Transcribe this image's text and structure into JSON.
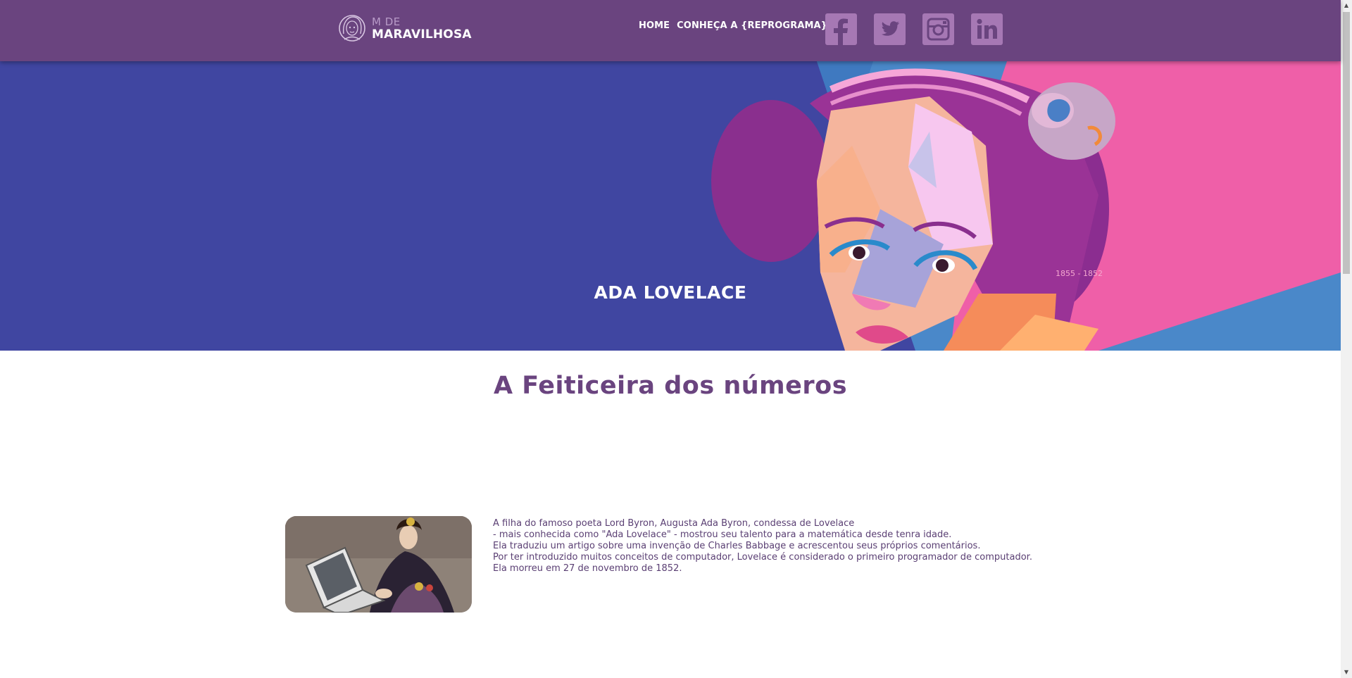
{
  "header": {
    "logo": {
      "line1": "M DE",
      "line2": "MARAVILHOSA",
      "icon": "woman-face-icon"
    },
    "nav": [
      {
        "label": "HOME"
      },
      {
        "label": "CONHEÇA A {REPROGRAMA}"
      }
    ],
    "social": [
      {
        "icon": "facebook-icon"
      },
      {
        "icon": "twitter-icon"
      },
      {
        "icon": "instagram-icon"
      },
      {
        "icon": "linkedin-icon"
      }
    ]
  },
  "hero": {
    "title": "ADA LOVELACE",
    "years": "1855 - 1852"
  },
  "main": {
    "title": "A Feiticeira dos números",
    "bio": [
      "A filha do famoso poeta Lord Byron, Augusta Ada Byron, condessa de Lovelace",
      "- mais conhecida como \"Ada Lovelace\" - mostrou seu talento para a matemática desde tenra idade.",
      "Ela traduziu um artigo sobre uma invenção de Charles Babbage e acrescentou seus próprios comentários.",
      "Por ter introduzido muitos conceitos de computador, Lovelace é considerado o primeiro programador de computador.",
      "Ela morreu em 27 de novembro de 1852."
    ]
  },
  "colors": {
    "header_bg": "#6a447f",
    "hero_bg": "#4046a1",
    "title_color": "#6a447f",
    "social_icon_bg": "#a678b4",
    "text_color": "#5a3f73"
  }
}
